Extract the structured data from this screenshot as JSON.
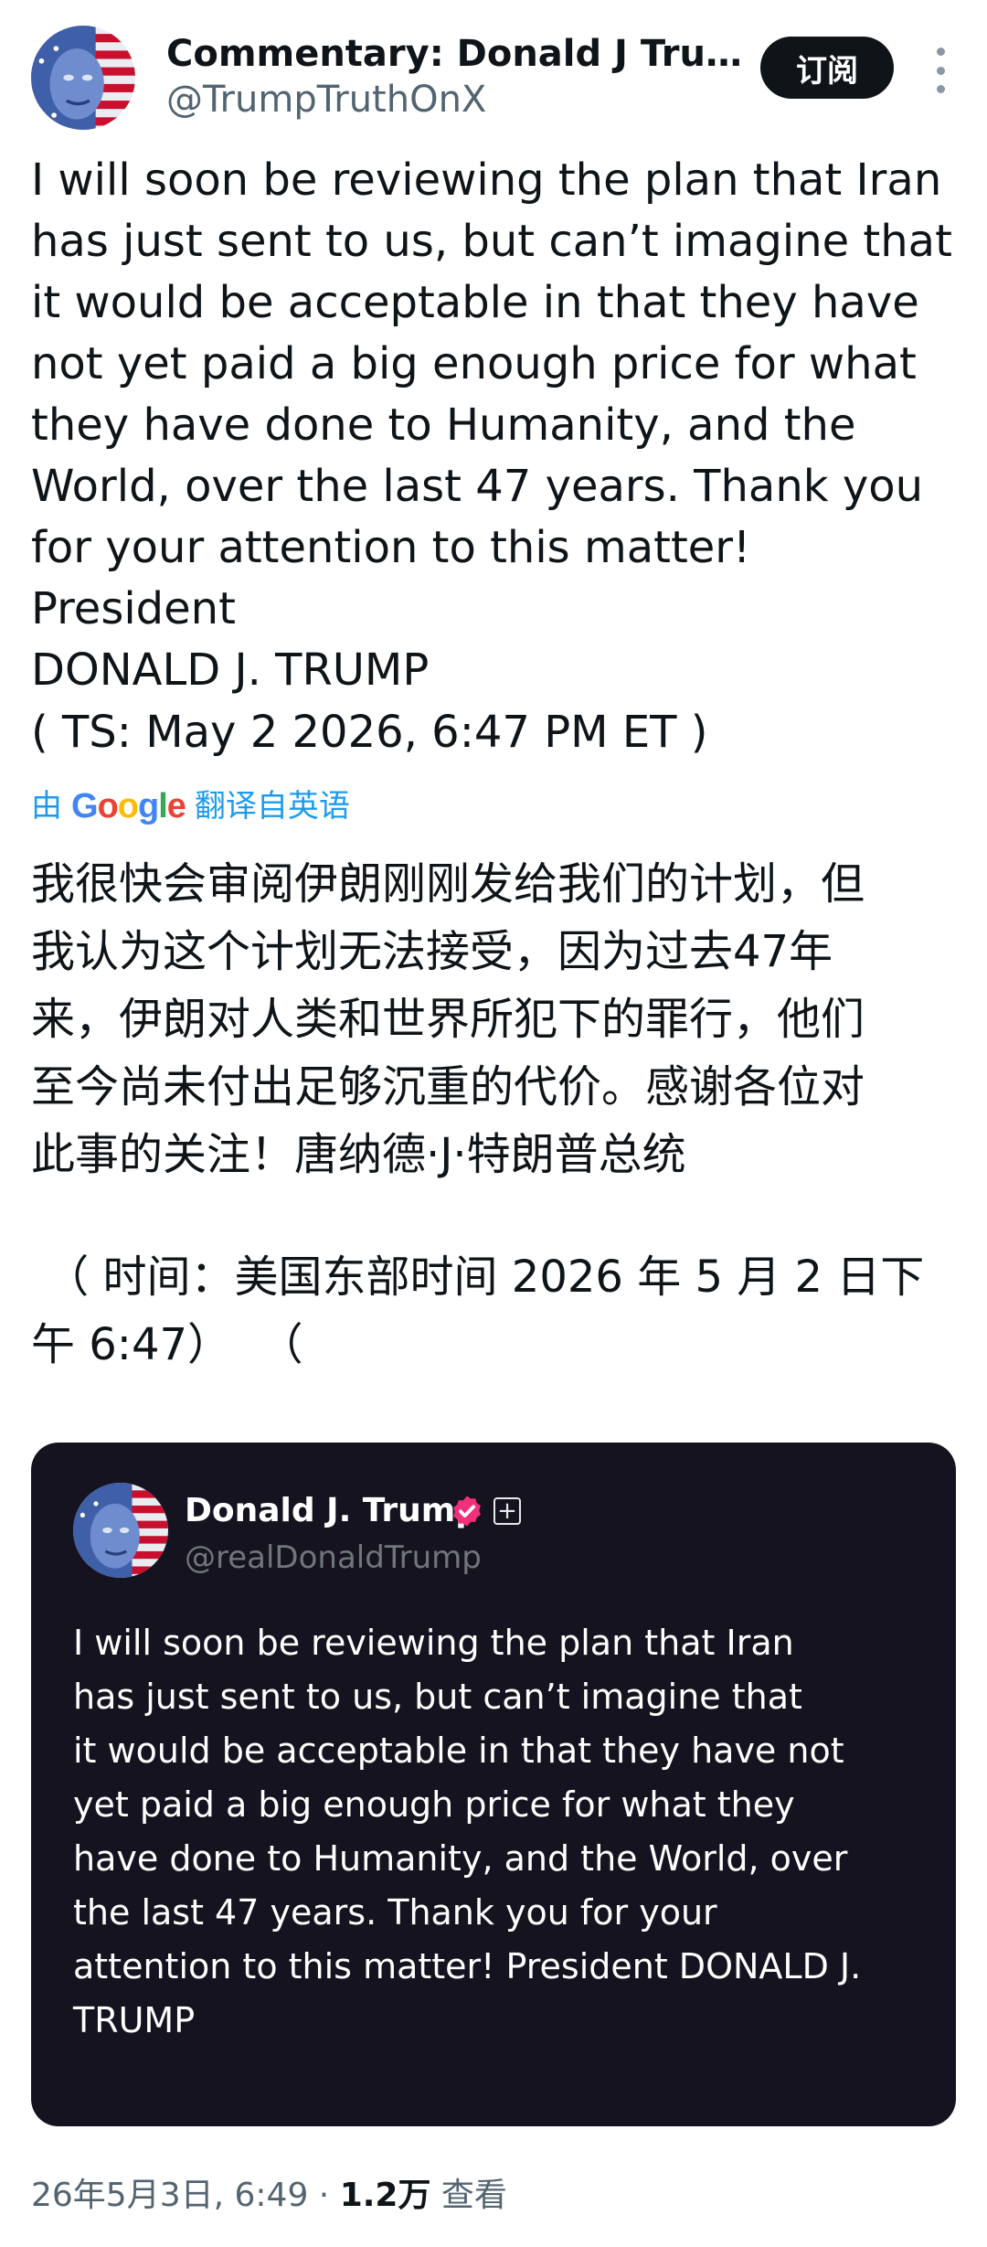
{
  "header": {
    "display_name": "Commentary: Donald J Trum...",
    "handle": "@TrumpTruthOnX",
    "subscribe_label": "订阅",
    "more_icon": "vertical-ellipsis-icon"
  },
  "post": {
    "text": "I will soon be reviewing the plan that Iran\nhas just sent to us, but can’t imagine that\nit would be acceptable in that they have\nnot yet paid a big enough price for what\nthey have done to Humanity, and the\nWorld, over the last 47 years. Thank you\nfor your attention to this matter! President\nDONALD J. TRUMP",
    "timestamp_note": "( TS: May 2 2026, 6:47 PM ET )"
  },
  "translation": {
    "prefix": "由",
    "provider": "Google",
    "suffix": "翻译自英语",
    "text": "我很快会审阅伊朗刚刚发给我们的计划，但\n我认为这个计划无法接受，因为过去47年\n来，伊朗对人类和世界所犯下的罪行，他们\n至今尚未付出足够沉重的代价。感谢各位对\n此事的关注！唐纳德·J·特朗普总统",
    "time_text": " （ 时间：美国东部时间 2026 年 5 月 2 日下\n午 6:47）  （"
  },
  "embedded_post": {
    "display_name": "Donald J. Trump",
    "handle": "@realDonaldTrump",
    "verified_color": "#f0307a",
    "text": "I will soon be reviewing the plan that Iran\nhas just sent to us, but can’t imagine that\nit would be acceptable in that they have not\nyet paid a big enough price for what they\nhave done to Humanity, and the World, over\nthe last 47 years. Thank you for your\nattention to this matter! President DONALD J.\nTRUMP"
  },
  "footer": {
    "date_time": "26年5月3日, 6:49 · ",
    "views_count": "1.2万",
    "views_label": " 查看"
  },
  "colors": {
    "accent": "#1d9bf0",
    "card_background": "#15131f",
    "subscribe_button": "#0f1419"
  }
}
